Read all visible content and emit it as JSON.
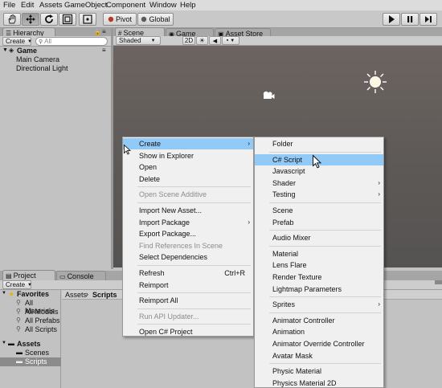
{
  "menubar": [
    "File",
    "Edit",
    "Assets",
    "GameObject",
    "Component",
    "Window",
    "Help"
  ],
  "toolbar": {
    "tools": [
      "hand-icon",
      "move-icon",
      "rotate-icon",
      "scale-icon"
    ],
    "pivot": "Pivot",
    "global": "Global",
    "play": [
      "play-icon",
      "pause-icon",
      "step-icon"
    ]
  },
  "hierarchy": {
    "tab": "Hierarchy",
    "create": "Create",
    "search_placeholder": "All",
    "scene_name": "Game",
    "items": [
      "Main Camera",
      "Directional Light"
    ]
  },
  "scene": {
    "tabs": [
      "Scene",
      "Game",
      "Asset Store"
    ],
    "shading": "Shaded",
    "mode_2d": "2D"
  },
  "project": {
    "tabs": [
      "Project",
      "Console"
    ],
    "create": "Create",
    "favorites_label": "Favorites",
    "favorites": [
      "All Materials",
      "All Models",
      "All Prefabs",
      "All Scripts"
    ],
    "assets_label": "Assets",
    "folders": [
      "Scenes",
      "Scripts"
    ],
    "breadcrumb": [
      "Assets",
      "Scripts"
    ]
  },
  "context_menu": {
    "items": [
      {
        "label": "Create",
        "submenu": true,
        "highlight": true
      },
      {
        "label": "Show in Explorer"
      },
      {
        "label": "Open"
      },
      {
        "label": "Delete"
      },
      {
        "sep": true
      },
      {
        "label": "Open Scene Additive",
        "disabled": true
      },
      {
        "sep": true
      },
      {
        "label": "Import New Asset..."
      },
      {
        "label": "Import Package",
        "submenu": true
      },
      {
        "label": "Export Package..."
      },
      {
        "label": "Find References In Scene",
        "disabled": true
      },
      {
        "label": "Select Dependencies"
      },
      {
        "sep": true
      },
      {
        "label": "Refresh",
        "shortcut": "Ctrl+R"
      },
      {
        "label": "Reimport"
      },
      {
        "sep": true
      },
      {
        "label": "Reimport All"
      },
      {
        "sep": true
      },
      {
        "label": "Run API Updater...",
        "disabled": true
      },
      {
        "sep": true
      },
      {
        "label": "Open C# Project"
      }
    ]
  },
  "create_submenu": {
    "items": [
      {
        "label": "Folder"
      },
      {
        "sep": true
      },
      {
        "label": "C# Script",
        "highlight": true
      },
      {
        "label": "Javascript"
      },
      {
        "label": "Shader",
        "submenu": true
      },
      {
        "label": "Testing",
        "submenu": true
      },
      {
        "sep": true
      },
      {
        "label": "Scene"
      },
      {
        "label": "Prefab"
      },
      {
        "sep": true
      },
      {
        "label": "Audio Mixer"
      },
      {
        "sep": true
      },
      {
        "label": "Material"
      },
      {
        "label": "Lens Flare"
      },
      {
        "label": "Render Texture"
      },
      {
        "label": "Lightmap Parameters"
      },
      {
        "sep": true
      },
      {
        "label": "Sprites",
        "submenu": true
      },
      {
        "sep": true
      },
      {
        "label": "Animator Controller"
      },
      {
        "label": "Animation"
      },
      {
        "label": "Animator Override Controller"
      },
      {
        "label": "Avatar Mask"
      },
      {
        "sep": true
      },
      {
        "label": "Physic Material"
      },
      {
        "label": "Physics Material 2D"
      }
    ]
  },
  "colors": {
    "menu_highlight": "#91c9f7",
    "scene_background": "#5d5956",
    "selection": "#8b8b8b"
  }
}
